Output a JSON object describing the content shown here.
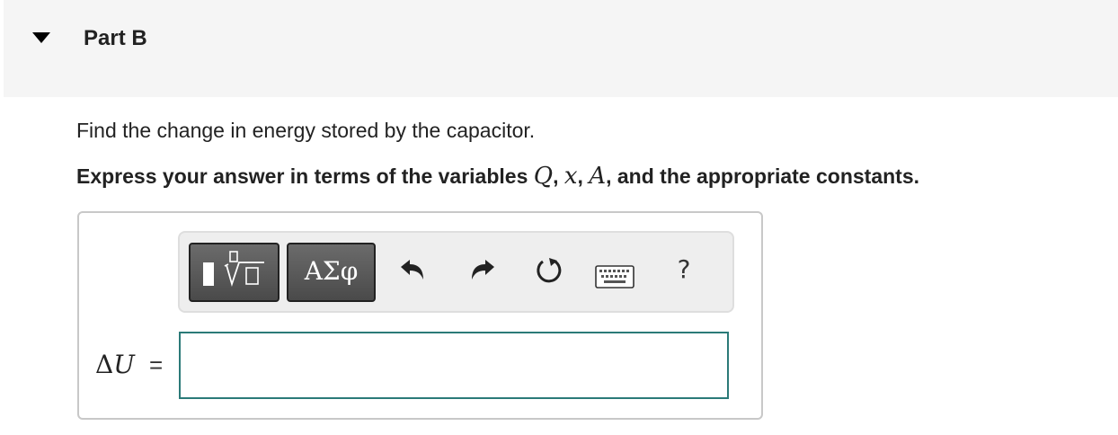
{
  "part": {
    "title": "Part B"
  },
  "question": {
    "prompt": "Find the change in energy stored by the capacitor.",
    "instructions_lead": "Express your answer in terms of the variables ",
    "var_q": "Q",
    "sep1": ", ",
    "var_x": "x",
    "sep2": ", ",
    "var_a": "A",
    "instructions_tail": ", and the appropriate constants."
  },
  "toolbar": {
    "templates_icon": "templates-icon",
    "greek_label": "ΑΣφ",
    "undo_icon": "undo-icon",
    "redo_icon": "redo-icon",
    "reset_icon": "reset-icon",
    "keyboard_icon": "keyboard-icon",
    "help_label": "?"
  },
  "answer": {
    "delta": "Δ",
    "variable": "U",
    "equals": "=",
    "value": ""
  },
  "colors": {
    "header_bg": "#f5f5f5",
    "input_border": "#2b7a78",
    "toolbar_button": "#595959"
  }
}
